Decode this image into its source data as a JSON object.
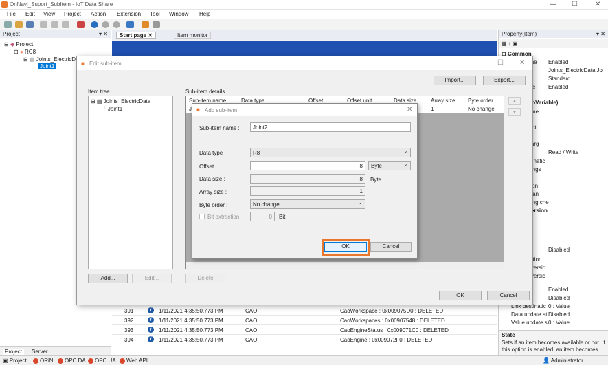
{
  "app": {
    "title": "OnNavi_Suport_SubItem - IoT Data Share"
  },
  "menu": [
    "File",
    "Edit",
    "View",
    "Project",
    "Action",
    "Extension",
    "Tool",
    "Window",
    "Help"
  ],
  "project_pane": {
    "title": "Project",
    "tree": [
      "Project",
      "RC8",
      "Joints_ElectricD",
      "Joint1"
    ],
    "tabs": [
      "Project",
      "Server"
    ]
  },
  "doc_tabs": [
    "Start page",
    "Item monitor"
  ],
  "edit_dialog": {
    "title": "Edit sub-item",
    "import_label": "Import...",
    "export_label": "Export...",
    "item_tree_label": "Item tree",
    "tree": [
      "Joints_ElectricData",
      "Joint1"
    ],
    "details_label": "Sub-item details",
    "columns": [
      "Sub-item name",
      "Data type",
      "Offset",
      "Offset unit",
      "Data size",
      "Array size",
      "Byte order"
    ],
    "row": {
      "name": "Jo",
      "array_size": "1",
      "byte_order": "No change"
    },
    "add_label": "Add...",
    "edit_label": "Edit...",
    "delete_label": "Delete",
    "ok_label": "OK",
    "cancel_label": "Cancel"
  },
  "add_dialog": {
    "title": "Add sub-item",
    "name_label": "Sub-item name :",
    "name_value": "Joint2",
    "data_type_label": "Data type :",
    "data_type_value": "R8",
    "offset_label": "Offset :",
    "offset_value": "8",
    "offset_unit": "Byte",
    "data_size_label": "Data size :",
    "data_size_value": "8",
    "data_size_unit": "Byte",
    "array_size_label": "Array size :",
    "array_size_value": "1",
    "byte_order_label": "Byte order :",
    "byte_order_value": "No change",
    "bit_extraction_label": "Bit extraction",
    "bit_value": "0",
    "bit_unit": "Bit",
    "ok_label": "OK",
    "cancel_label": "Cancel"
  },
  "log": [
    {
      "id": "391",
      "time": "1/11/2021 4:35:50.773 PM",
      "src": "CAO",
      "msg": "CaoWorkspace : 0x009075D0 : DELETED"
    },
    {
      "id": "392",
      "time": "1/11/2021 4:35:50.773 PM",
      "src": "CAO",
      "msg": "CaoWorkspaces : 0x00907548 : DELETED"
    },
    {
      "id": "393",
      "time": "1/11/2021 4:35:50.773 PM",
      "src": "CAO",
      "msg": "CaoEngineStatus : 0x009071C0 : DELETED"
    },
    {
      "id": "394",
      "time": "1/11/2021 4:35:50.773 PM",
      "src": "CAO",
      "msg": "CaoEngine : 0x009072F0 : DELETED"
    }
  ],
  "property": {
    "title": "Property(Item)",
    "section": "Common",
    "left": [
      "ame",
      "ode",
      "CaoVariable)",
      "name",
      "bject",
      "g targ",
      "estinatic",
      "ettings",
      "n",
      "settin",
      "n ban",
      "aging che",
      "aversion",
      "eration",
      "onversic",
      "onversic",
      "ement",
      "ement",
      "Link destinatic",
      "Data update at",
      "Value update s"
    ],
    "right": [
      "Enabled",
      "Joints_ElectricData|Jo",
      "Standard",
      "Enabled",
      "Read / Write",
      "Disabled",
      "Enabled",
      "Disabled",
      "0 : Value",
      "Disabled",
      "0 : Value"
    ],
    "state_title": "State",
    "state_desc": "Sets if an item becomes available or not. If this option is enabled, an item becomes"
  },
  "statusbar": {
    "items": [
      "Project",
      "ORiN",
      "OPC DA",
      "OPC UA",
      "Web API"
    ],
    "user": "Administrator"
  }
}
